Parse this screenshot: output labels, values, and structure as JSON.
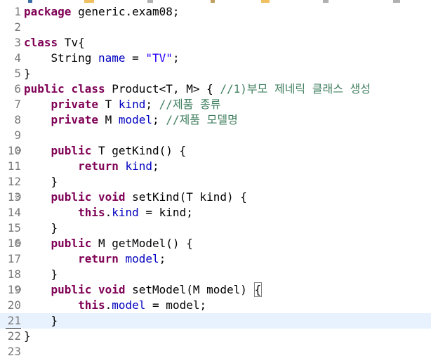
{
  "editor": {
    "lines": [
      {
        "n": "1",
        "tokens": [
          {
            "t": "package",
            "c": "kw"
          },
          {
            "t": " generic.exam08;"
          }
        ]
      },
      {
        "n": "2",
        "tokens": []
      },
      {
        "n": "3",
        "tokens": [
          {
            "t": "class",
            "c": "kw"
          },
          {
            "t": " Tv{"
          }
        ]
      },
      {
        "n": "4",
        "tokens": [
          {
            "t": "    String "
          },
          {
            "t": "name",
            "c": "fld"
          },
          {
            "t": " = "
          },
          {
            "t": "\"TV\"",
            "c": "str"
          },
          {
            "t": ";"
          }
        ]
      },
      {
        "n": "5",
        "tokens": [
          {
            "t": "}"
          }
        ]
      },
      {
        "n": "6",
        "tokens": [
          {
            "t": "public",
            "c": "kw"
          },
          {
            "t": " "
          },
          {
            "t": "class",
            "c": "kw"
          },
          {
            "t": " Product<T, M> { "
          },
          {
            "t": "//1)부모 제네릭 클래스 생성",
            "c": "cmt"
          }
        ]
      },
      {
        "n": "7",
        "tokens": [
          {
            "t": "    "
          },
          {
            "t": "private",
            "c": "kw"
          },
          {
            "t": " T "
          },
          {
            "t": "kind",
            "c": "fld"
          },
          {
            "t": "; "
          },
          {
            "t": "//제품 종류",
            "c": "cmt"
          }
        ]
      },
      {
        "n": "8",
        "tokens": [
          {
            "t": "    "
          },
          {
            "t": "private",
            "c": "kw"
          },
          {
            "t": " M "
          },
          {
            "t": "model",
            "c": "fld"
          },
          {
            "t": "; "
          },
          {
            "t": "//제품 모델명",
            "c": "cmt"
          }
        ]
      },
      {
        "n": "9",
        "tokens": []
      },
      {
        "n": "10",
        "fold": true,
        "tokens": [
          {
            "t": "    "
          },
          {
            "t": "public",
            "c": "kw"
          },
          {
            "t": " T getKind() {"
          }
        ]
      },
      {
        "n": "11",
        "tokens": [
          {
            "t": "        "
          },
          {
            "t": "return",
            "c": "kw"
          },
          {
            "t": " "
          },
          {
            "t": "kind",
            "c": "fld"
          },
          {
            "t": ";"
          }
        ]
      },
      {
        "n": "12",
        "tokens": [
          {
            "t": "    }"
          }
        ]
      },
      {
        "n": "13",
        "fold": true,
        "tokens": [
          {
            "t": "    "
          },
          {
            "t": "public",
            "c": "kw"
          },
          {
            "t": " "
          },
          {
            "t": "void",
            "c": "kw"
          },
          {
            "t": " setKind(T kind) {"
          }
        ]
      },
      {
        "n": "14",
        "tokens": [
          {
            "t": "        "
          },
          {
            "t": "this",
            "c": "kw"
          },
          {
            "t": "."
          },
          {
            "t": "kind",
            "c": "fld"
          },
          {
            "t": " = kind;"
          }
        ]
      },
      {
        "n": "15",
        "tokens": [
          {
            "t": "    }"
          }
        ]
      },
      {
        "n": "16",
        "fold": true,
        "tokens": [
          {
            "t": "    "
          },
          {
            "t": "public",
            "c": "kw"
          },
          {
            "t": " M getModel() {"
          }
        ]
      },
      {
        "n": "17",
        "tokens": [
          {
            "t": "        "
          },
          {
            "t": "return",
            "c": "kw"
          },
          {
            "t": " "
          },
          {
            "t": "model",
            "c": "fld"
          },
          {
            "t": ";"
          }
        ]
      },
      {
        "n": "18",
        "tokens": [
          {
            "t": "    }"
          }
        ]
      },
      {
        "n": "19",
        "fold": true,
        "tokens": [
          {
            "t": "    "
          },
          {
            "t": "public",
            "c": "kw"
          },
          {
            "t": " "
          },
          {
            "t": "void",
            "c": "kw"
          },
          {
            "t": " setModel(M model) "
          },
          {
            "t": "{",
            "c": "box"
          }
        ]
      },
      {
        "n": "20",
        "tokens": [
          {
            "t": "        "
          },
          {
            "t": "this",
            "c": "kw"
          },
          {
            "t": "."
          },
          {
            "t": "model",
            "c": "fld"
          },
          {
            "t": " = model;"
          }
        ]
      },
      {
        "n": "21",
        "current": true,
        "tokens": [
          {
            "t": "    }"
          }
        ]
      },
      {
        "n": "22",
        "tokens": [
          {
            "t": "}"
          }
        ]
      },
      {
        "n": "23",
        "tokens": []
      }
    ]
  },
  "colors": {
    "keyword": "#7f0055",
    "field": "#0000c0",
    "string": "#2a00ff",
    "comment": "#3f7f5f",
    "current_line": "#e8f2fe"
  }
}
